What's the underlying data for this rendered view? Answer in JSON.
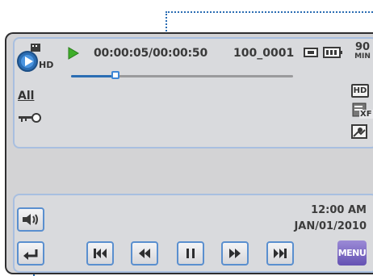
{
  "playback": {
    "time": "00:00:05/00:00:50",
    "file_number": "100_0001",
    "progress": 0.2
  },
  "status": {
    "video_mode": "HD",
    "recording_format": "HD",
    "storage": "90",
    "storage_unit": "MIN",
    "all_label": "All",
    "xf_label": "XF"
  },
  "datetime": {
    "time": "12:00 AM",
    "date": "JAN/01/2010"
  },
  "controls": {
    "menu_label": "MENU"
  },
  "colors": {
    "accent_blue": "#2b6db3",
    "play_green": "#3fae2a",
    "menu_purple": "#7a66c4"
  }
}
